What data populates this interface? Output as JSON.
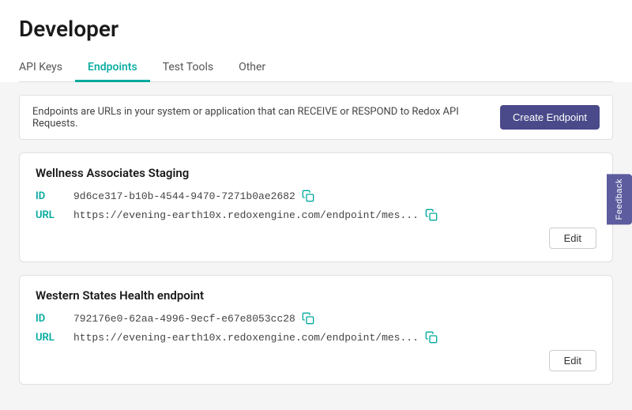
{
  "page": {
    "title": "Developer",
    "cursor": true
  },
  "nav": {
    "tabs": [
      {
        "id": "api-keys",
        "label": "API Keys",
        "active": false
      },
      {
        "id": "endpoints",
        "label": "Endpoints",
        "active": true
      },
      {
        "id": "test-tools",
        "label": "Test Tools",
        "active": false
      },
      {
        "id": "other",
        "label": "Other",
        "active": false
      }
    ]
  },
  "banner": {
    "text": "Endpoints are URLs in your system or application that can RECEIVE or RESPOND to Redox API Requests.",
    "button_label": "Create Endpoint"
  },
  "endpoints": [
    {
      "id": "endpoint-1",
      "title": "Wellness Associates Staging",
      "id_label": "ID",
      "id_value": "9d6ce317-b10b-4544-9470-7271b0ae2682",
      "url_label": "URL",
      "url_value": "https://evening-earth10x.redoxengine.com/endpoint/mes...",
      "edit_label": "Edit"
    },
    {
      "id": "endpoint-2",
      "title": "Western States Health endpoint",
      "id_label": "ID",
      "id_value": "792176e0-62aa-4996-9ecf-e67e8053cc28",
      "url_label": "URL",
      "url_value": "https://evening-earth10x.redoxengine.com/endpoint/mes...",
      "edit_label": "Edit"
    }
  ],
  "feedback": {
    "label": "Feedback"
  }
}
